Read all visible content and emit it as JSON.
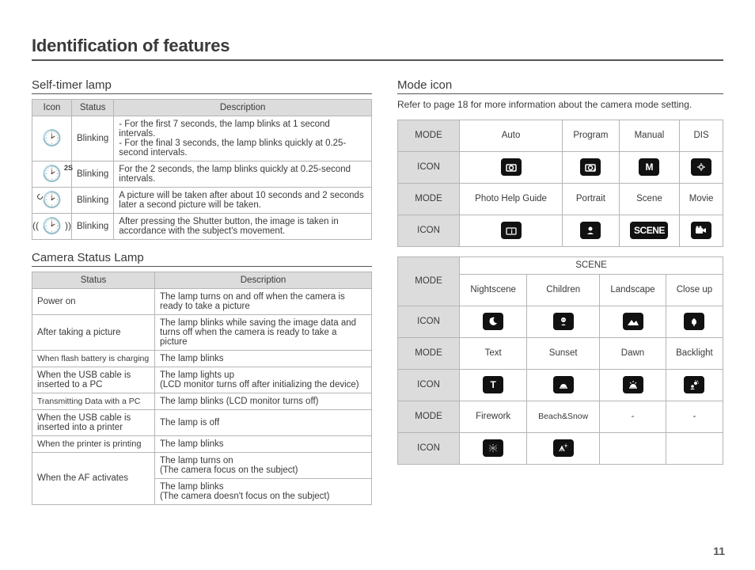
{
  "page": {
    "title": "Identification of features",
    "number": "11"
  },
  "labels": {
    "icon_col": "Icon",
    "status_col": "Status",
    "desc_col": "Description",
    "mode_label": "MODE",
    "icon_label": "ICON",
    "scene_header": "SCENE",
    "dash": "-"
  },
  "self_timer": {
    "heading": "Self-timer lamp",
    "rows": [
      {
        "icon_sup": "",
        "status": "Blinking",
        "desc": "- For the first 7 seconds, the lamp blinks at 1 second intervals.\n- For the final 3 seconds, the lamp blinks quickly at 0.25-second intervals."
      },
      {
        "icon_sup": "2S",
        "status": "Blinking",
        "desc": "For the 2 seconds, the lamp blinks quickly at 0.25-second intervals."
      },
      {
        "icon_sup": "",
        "status": "Blinking",
        "desc": "A picture will be taken after about 10 seconds and 2 seconds later a second picture will be taken."
      },
      {
        "icon_sup": "",
        "status": "Blinking",
        "desc": "After pressing the Shutter button, the image is taken in accordance with the subject's movement."
      }
    ]
  },
  "camera_status": {
    "heading": "Camera Status Lamp",
    "rows": [
      {
        "status": "Power on",
        "desc": "The lamp turns on and off when the camera is ready to take a picture"
      },
      {
        "status": "After taking a picture",
        "desc": "The lamp blinks while saving the image data and turns off when the camera is ready to take a picture"
      },
      {
        "status": "When flash battery is charging",
        "desc": "The lamp blinks"
      },
      {
        "status": "When the USB cable is inserted to a PC",
        "desc": "The lamp lights up\n(LCD monitor turns off after initializing the device)"
      },
      {
        "status": "Transmitting Data with a PC",
        "desc": "The lamp blinks (LCD monitor turns off)"
      },
      {
        "status": "When the USB cable is inserted into a printer",
        "desc": "The lamp is off"
      },
      {
        "status": "When the printer is printing",
        "desc": "The lamp blinks"
      }
    ],
    "af_row": {
      "status": "When the AF activates",
      "desc1": "The lamp turns on\n(The camera focus on the subject)",
      "desc2": "The lamp blinks\n(The camera doesn't focus on the subject)"
    }
  },
  "mode_icon": {
    "heading": "Mode icon",
    "note": "Refer to page 18 for more information about the camera mode setting.",
    "group1": [
      {
        "mode": "Auto",
        "icon": "auto"
      },
      {
        "mode": "Program",
        "icon": "program"
      },
      {
        "mode": "Manual",
        "icon": "manual"
      },
      {
        "mode": "DIS",
        "icon": "dis"
      },
      {
        "mode": "Photo Help Guide",
        "icon": "help"
      },
      {
        "mode": "Portrait",
        "icon": "portrait"
      },
      {
        "mode": "Scene",
        "icon": "scene"
      },
      {
        "mode": "Movie",
        "icon": "movie"
      }
    ],
    "scene": [
      {
        "mode": "Nightscene",
        "icon": "night"
      },
      {
        "mode": "Children",
        "icon": "children"
      },
      {
        "mode": "Landscape",
        "icon": "landscape"
      },
      {
        "mode": "Close up",
        "icon": "closeup"
      },
      {
        "mode": "Text",
        "icon": "text"
      },
      {
        "mode": "Sunset",
        "icon": "sunset"
      },
      {
        "mode": "Dawn",
        "icon": "dawn"
      },
      {
        "mode": "Backlight",
        "icon": "backlight"
      },
      {
        "mode": "Firework",
        "icon": "firework"
      },
      {
        "mode": "Beach&Snow",
        "icon": "beach"
      },
      {
        "mode": "-",
        "icon": ""
      },
      {
        "mode": "-",
        "icon": ""
      }
    ]
  }
}
